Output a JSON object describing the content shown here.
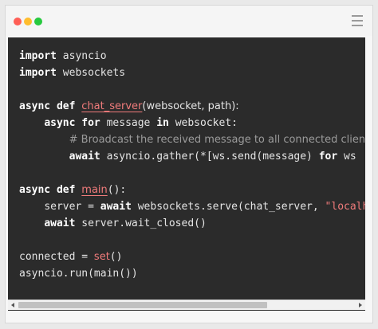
{
  "window": {
    "controls": {
      "close_color": "#ff5f56",
      "minimize_color": "#ffbd2e",
      "maximize_color": "#27c93f"
    },
    "menu_icon": "hamburger-menu-icon"
  },
  "code": {
    "l1": {
      "kw": "import",
      "rest": " asyncio"
    },
    "l2": {
      "kw": "import",
      "rest": " websockets"
    },
    "l3": {
      "kw1": "async",
      "kw2": " def ",
      "fn": "chat_server",
      "params": "(websocket, path):"
    },
    "l4": {
      "indent": "    ",
      "kw1": "async",
      "kw2": " for",
      "mid": " message ",
      "kw3": "in",
      "rest": " websocket:"
    },
    "l5": {
      "indent": "        ",
      "comment": "# Broadcast the received message to all connected clients"
    },
    "l6": {
      "indent": "        ",
      "kw": "await",
      "rest": " asyncio.gather(*[ws.send(message) ",
      "kw2": "for",
      "tail": " ws"
    },
    "l7": {
      "kw1": "async",
      "kw2": " def ",
      "fn": "main",
      "rest": "():"
    },
    "l8": {
      "indent": "    ",
      "pre": "server = ",
      "kw": "await",
      "rest": " websockets.serve(chat_server, ",
      "str": "\"localh"
    },
    "l9": {
      "indent": "    ",
      "kw": "await",
      "rest": " server.wait_closed()"
    },
    "l10": {
      "pre": "connected = ",
      "fn": "set",
      "rest": "()"
    },
    "l11": {
      "text": "asyncio.run(main())"
    }
  },
  "scrollbar": {
    "thumb_fraction": 0.74
  }
}
